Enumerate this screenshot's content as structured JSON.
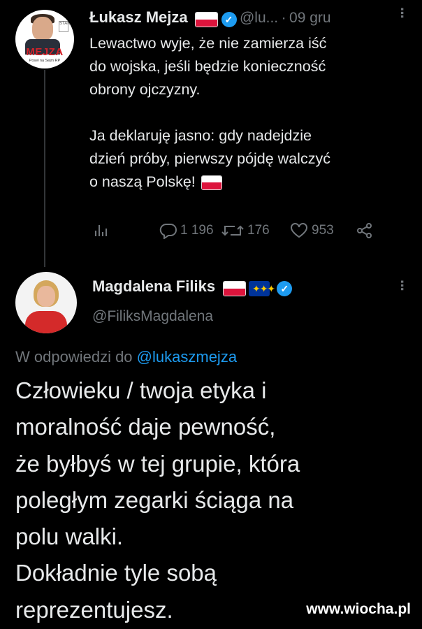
{
  "tweet1": {
    "author_name": "Łukasz Mejza",
    "handle": "@lu...",
    "separator": "·",
    "date": "09 gru",
    "avatar_text": "MEJZA",
    "avatar_subtext": "Poseł na Sejm RP",
    "avatar_emblem_text": "STAN",
    "text": "Lewactwo wyje, że nie zamierza iść\ndo wojska, jeśli będzie konieczność\nobrony ojczyzny.\n\nJa deklaruję jasno: gdy nadejdzie\ndzień próby, pierwszy pójdę walczyć\no naszą Polskę!",
    "flag_emoji_name": "flag-poland-icon",
    "replies": "1 196",
    "retweets": "176",
    "likes": "953"
  },
  "tweet2": {
    "author_name": "Magdalena Filiks",
    "handle": "@FiliksMagdalena",
    "reply_prefix": "W odpowiedzi do",
    "reply_mention": "@lukaszmejza",
    "text": "Człowieku / twoja etyka i\nmoralność daje pewność,\nże byłbyś w tej grupie, która\npoległym zegarki ściąga na\npolu walki.\nDokładnie tyle sobą\nreprezentujesz."
  },
  "watermark": "www.wiocha.pl",
  "colors": {
    "background": "#000000",
    "text": "#e7e9ea",
    "muted": "#71767b",
    "accent": "#1d9bf0"
  }
}
